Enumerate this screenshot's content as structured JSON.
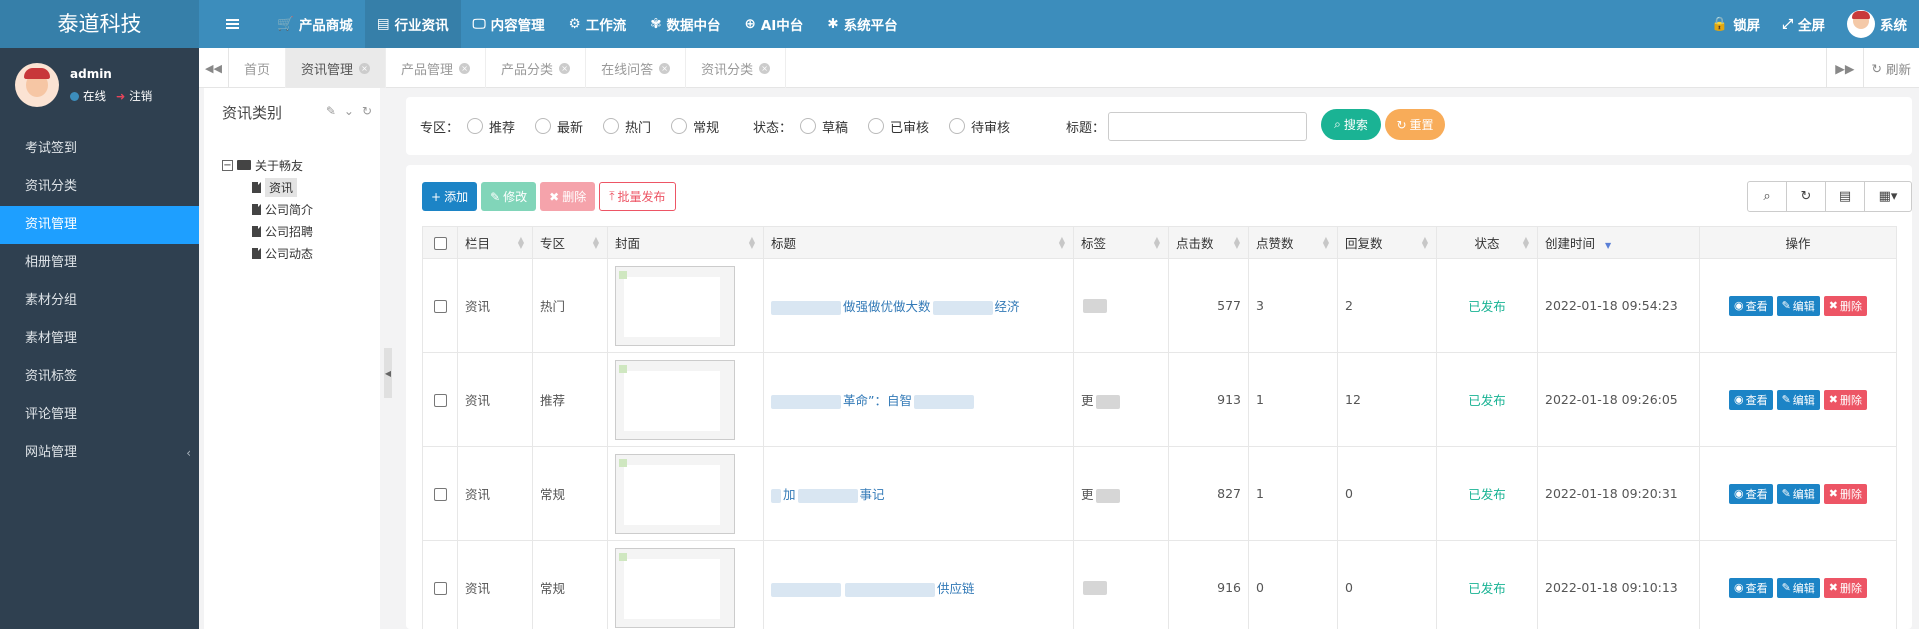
{
  "app": {
    "title": "泰道科技"
  },
  "topnav": [
    {
      "icon": "cart-icon",
      "glyph": "🛒",
      "label": "产品商城"
    },
    {
      "icon": "newspaper-icon",
      "glyph": "▤",
      "label": "行业资讯",
      "active": true
    },
    {
      "icon": "monitor-icon",
      "glyph": "🖵",
      "label": "内容管理"
    },
    {
      "icon": "cogs-icon",
      "glyph": "⚙",
      "label": "工作流"
    },
    {
      "icon": "database-icon",
      "glyph": "✾",
      "label": "数据中台"
    },
    {
      "icon": "globe-icon",
      "glyph": "⊕",
      "label": "AI中台"
    },
    {
      "icon": "gear-icon",
      "glyph": "✱",
      "label": "系统平台"
    }
  ],
  "topright": {
    "lock": "锁屏",
    "fullscreen": "全屏",
    "user": "系统"
  },
  "user": {
    "name": "admin",
    "status": "在线",
    "logout": "注销"
  },
  "sidebar": {
    "items": [
      {
        "label": "考试签到"
      },
      {
        "label": "资讯分类"
      },
      {
        "label": "资讯管理",
        "active": true
      },
      {
        "label": "相册管理"
      },
      {
        "label": "素材分组"
      },
      {
        "label": "素材管理"
      },
      {
        "label": "资讯标签"
      },
      {
        "label": "评论管理"
      },
      {
        "label": "网站管理",
        "caret": "‹"
      }
    ]
  },
  "tabs": [
    {
      "label": "首页",
      "closable": false
    },
    {
      "label": "资讯管理",
      "closable": true,
      "active": true
    },
    {
      "label": "产品管理",
      "closable": true
    },
    {
      "label": "产品分类",
      "closable": true
    },
    {
      "label": "在线问答",
      "closable": true
    },
    {
      "label": "资讯分类",
      "closable": true
    }
  ],
  "tabs_right": {
    "refresh": "刷新"
  },
  "category": {
    "title": "资讯类别",
    "root": "关于畅友",
    "children": [
      {
        "label": "资讯",
        "selected": true
      },
      {
        "label": "公司简介"
      },
      {
        "label": "公司招聘"
      },
      {
        "label": "公司动态"
      }
    ]
  },
  "search": {
    "zone_label": "专区：",
    "zone_options": [
      "推荐",
      "最新",
      "热门",
      "常规"
    ],
    "status_label": "状态：",
    "status_options": [
      "草稿",
      "已审核",
      "待审核"
    ],
    "title_label": "标题：",
    "title_value": "",
    "search_btn": "搜索",
    "reset_btn": "重置"
  },
  "toolbar": {
    "add": "添加",
    "edit": "修改",
    "delete": "删除",
    "publish": "批量发布"
  },
  "table": {
    "columns": [
      "栏目",
      "专区",
      "封面",
      "标题",
      "标签",
      "点击数",
      "点赞数",
      "回复数",
      "状态",
      "创建时间",
      "操作"
    ],
    "rows": [
      {
        "column": "资讯",
        "zone": "热门",
        "title_a": "做强做优做大数",
        "title_b": "经济",
        "tag": "",
        "clicks": "577",
        "likes": "3",
        "replies": "2",
        "status": "已发布",
        "created": "2022-01-18 09:54:23"
      },
      {
        "column": "资讯",
        "zone": "推荐",
        "title_a": "革命”：自智",
        "title_b": "",
        "tag": "更",
        "clicks": "913",
        "likes": "1",
        "replies": "12",
        "status": "已发布",
        "created": "2022-01-18 09:26:05"
      },
      {
        "column": "资讯",
        "zone": "常规",
        "title_a": "加",
        "title_b": "事记",
        "tag": "更",
        "clicks": "827",
        "likes": "1",
        "replies": "0",
        "status": "已发布",
        "created": "2022-01-18 09:20:31"
      },
      {
        "column": "资讯",
        "zone": "常规",
        "title_a": "",
        "title_b": "供应链",
        "tag": "",
        "clicks": "916",
        "likes": "0",
        "replies": "0",
        "status": "已发布",
        "created": "2022-01-18 09:10:13"
      }
    ],
    "ops": {
      "view": "查看",
      "edit": "编辑",
      "delete": "删除"
    }
  },
  "colors": {
    "header": "#3c8dbc",
    "sidebar": "#2f4050",
    "active_menu": "#1e9fff",
    "success": "#1ab394",
    "warning": "#f8ac59",
    "danger": "#ed5565",
    "primary": "#1c84c6"
  }
}
